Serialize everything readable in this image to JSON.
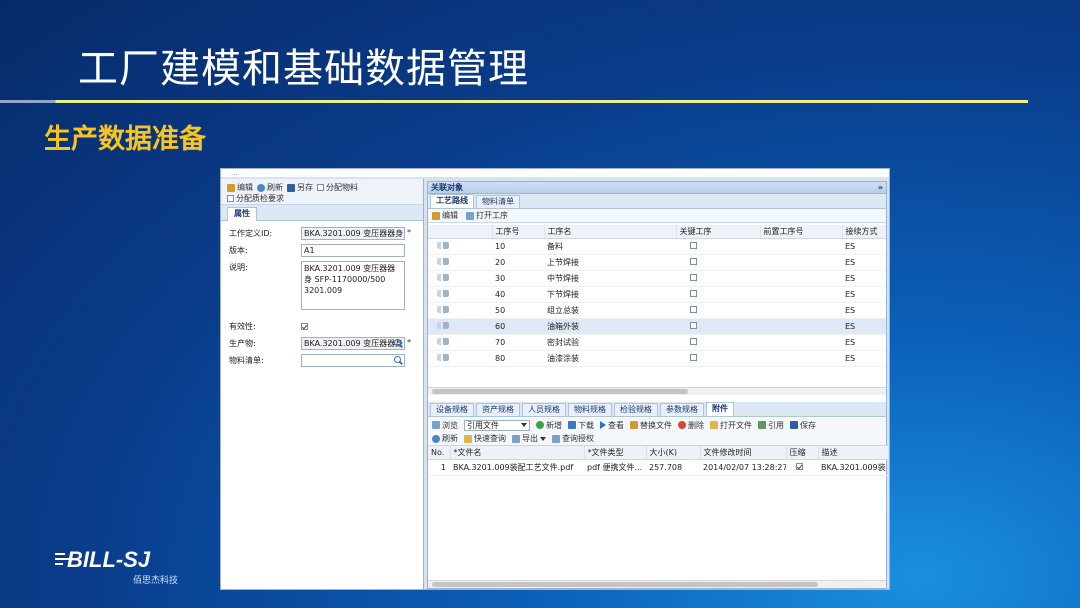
{
  "slide": {
    "title": "工厂建模和基础数据管理",
    "subtitle": "生产数据准备",
    "logo_text": "BILL-SJ",
    "logo_sub": "佰思杰科技",
    "title_color": "#ffffff",
    "subtitle_color": "#f7c51f"
  },
  "window": {
    "top_strip_text": "... ",
    "left_toolbar": {
      "edit": "编辑",
      "refresh": "刷新",
      "save_as": "另存",
      "assign_material": "分配物料",
      "assign_quality": "分配质检要求"
    },
    "left_tab": "属性",
    "form": {
      "process_def_id_label": "工作定义ID:",
      "process_def_id_value": "BKA.3201.009 变压器器身",
      "version_label": "版本:",
      "version_value": "A1",
      "desc_label": "说明:",
      "desc_value": "BKA.3201.009 变压器器身 SFP-1170000/500 3201.009",
      "valid_label": "有效性:",
      "product_label": "生产物:",
      "product_value": "BKA.3201.009 变压器器身",
      "bom_label": "物料清单:",
      "bom_value": ""
    },
    "right_panel": {
      "header": "关联对象",
      "collapse": "»",
      "tabs": [
        "工艺路线",
        "物料清单"
      ],
      "sub_toolbar": {
        "edit": "编辑",
        "open_op": "打开工序"
      },
      "ops_columns": [
        "",
        "工序号",
        "工序名",
        "关键工序",
        "前置工序号",
        "接续方式"
      ],
      "ops_rows": [
        {
          "no": "10",
          "name": "备料",
          "key": false,
          "type": "ES"
        },
        {
          "no": "20",
          "name": "上节焊接",
          "key": false,
          "type": "ES"
        },
        {
          "no": "30",
          "name": "中节焊接",
          "key": false,
          "type": "ES"
        },
        {
          "no": "40",
          "name": "下节焊接",
          "key": false,
          "type": "ES"
        },
        {
          "no": "50",
          "name": "组立总装",
          "key": false,
          "type": "ES"
        },
        {
          "no": "60",
          "name": "油箱外装",
          "key": false,
          "type": "ES"
        },
        {
          "no": "70",
          "name": "密封试验",
          "key": false,
          "type": "ES"
        },
        {
          "no": "80",
          "name": "油漆涂装",
          "key": false,
          "type": "ES"
        }
      ],
      "selected_row": 5,
      "lower_tabs": [
        "设备规格",
        "资产规格",
        "人员规格",
        "物料规格",
        "检验规格",
        "参数规格",
        "附件"
      ],
      "lower_toolbar1": {
        "browse": "浏览",
        "select_value": "引用文件",
        "new": "新增",
        "download": "下载",
        "view": "查看",
        "replace": "替换文件",
        "delete": "删除",
        "open_file": "打开文件",
        "reference": "引用",
        "save": "保存"
      },
      "lower_toolbar2": {
        "refresh": "刷新",
        "quick_query": "快速查询",
        "export": "导出",
        "query_auth": "查询授权"
      },
      "file_columns": [
        "No.",
        "*文件名",
        "*文件类型",
        "大小(K)",
        "文件修改时间",
        "压缩",
        "描述"
      ],
      "file_rows": [
        {
          "no": "1",
          "name": "BKA.3201.009装配工艺文件.pdf",
          "type": "pdf 便携文件...",
          "size": "257.708",
          "time": "2014/02/07 13:28:27",
          "compressed": true,
          "desc": "BKA.3201.009装"
        }
      ]
    }
  }
}
